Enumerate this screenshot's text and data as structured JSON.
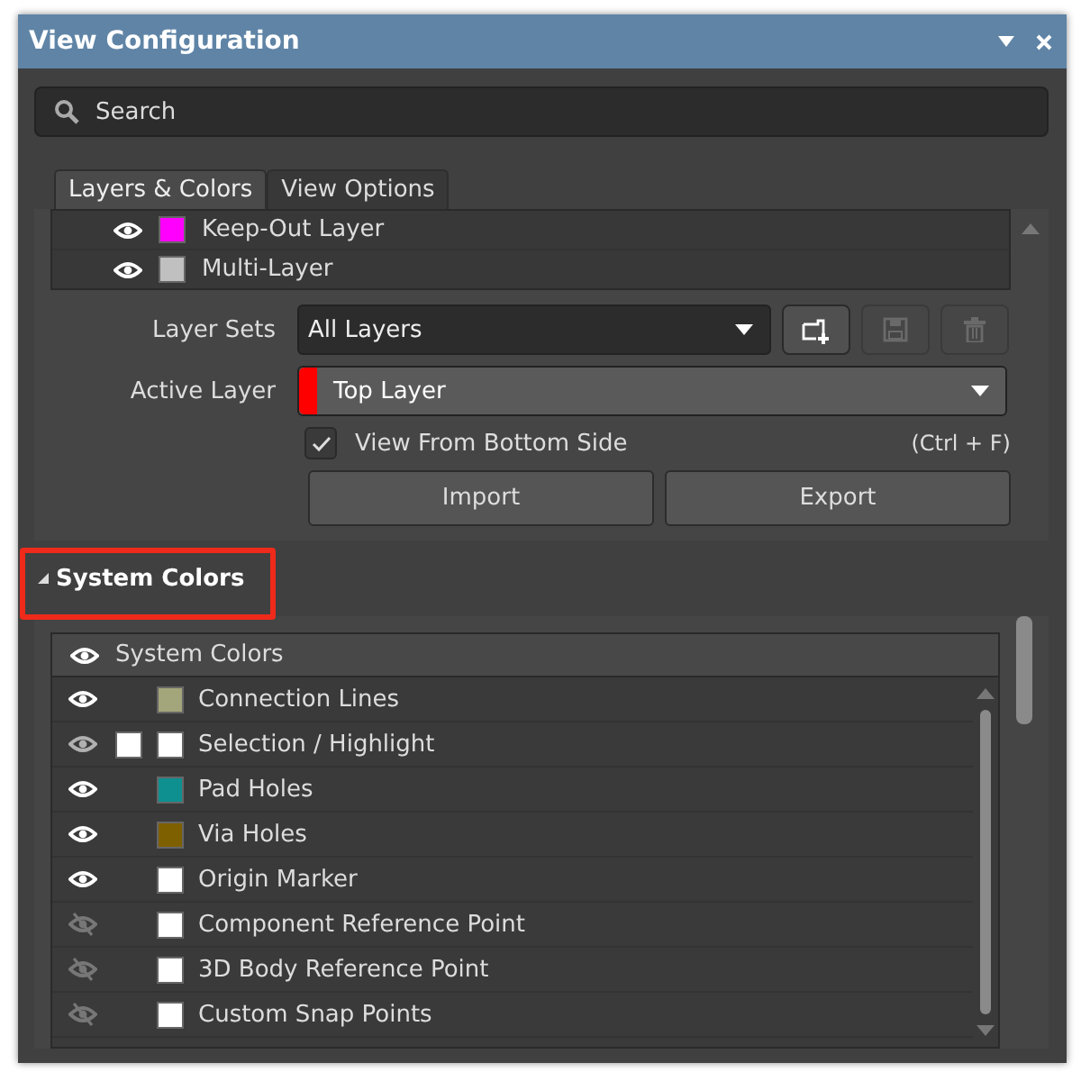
{
  "window": {
    "title": "View Configuration"
  },
  "search": {
    "placeholder": "Search"
  },
  "tabs": [
    {
      "label": "Layers & Colors",
      "selected": true
    },
    {
      "label": "View Options",
      "selected": false
    }
  ],
  "layers": [
    {
      "name": "Keep-Out Layer",
      "color": "#ff00ff",
      "visible": true
    },
    {
      "name": "Multi-Layer",
      "color": "#c0c0c0",
      "visible": true
    }
  ],
  "layer_sets": {
    "label": "Layer Sets",
    "value": "All Layers"
  },
  "icon_buttons": [
    {
      "kind": "add",
      "disabled": false
    },
    {
      "kind": "save",
      "disabled": true
    },
    {
      "kind": "delete",
      "disabled": true
    }
  ],
  "active_layer": {
    "label": "Active Layer",
    "value": "Top Layer",
    "color": "#ff0000"
  },
  "view_from_bottom": {
    "label": "View From Bottom Side",
    "checked": true,
    "shortcut": "(Ctrl + F)"
  },
  "buttons": [
    "Import",
    "Export"
  ],
  "system_colors": {
    "title": "System Colors",
    "expanded": true,
    "highlighted": true,
    "header": {
      "label": "System Colors",
      "visible": true
    },
    "rows": [
      {
        "name": "Connection Lines",
        "color": "#a3a57a",
        "visible": true
      },
      {
        "name": "Selection / Highlight",
        "color": "#ffffff",
        "kind": "dual",
        "visible": true
      },
      {
        "name": "Pad Holes",
        "color": "#0f9090",
        "visible": true
      },
      {
        "name": "Via Holes",
        "color": "#7f6000",
        "visible": true
      },
      {
        "name": "Origin Marker",
        "color": "#ffffff",
        "visible": true
      },
      {
        "name": "Component Reference Point",
        "color": "#ffffff",
        "visible": false
      },
      {
        "name": "3D Body Reference Point",
        "color": "#ffffff",
        "visible": false
      },
      {
        "name": "Custom Snap Points",
        "color": "#ffffff",
        "visible": false
      }
    ]
  }
}
